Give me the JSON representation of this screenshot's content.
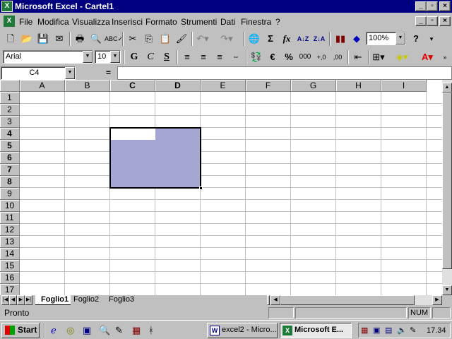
{
  "window": {
    "title": "Microsoft Excel - Cartel1"
  },
  "menu": [
    {
      "label": "File"
    },
    {
      "label": "Modifica"
    },
    {
      "label": "Visualizza"
    },
    {
      "label": "Inserisci"
    },
    {
      "label": "Formato"
    },
    {
      "label": "Strumenti"
    },
    {
      "label": "Dati"
    },
    {
      "label": "Finestra"
    },
    {
      "label": "?"
    }
  ],
  "standard_toolbar": {
    "zoom": "100%",
    "sigma": "Σ",
    "fx": "fx"
  },
  "format_toolbar": {
    "font": "Arial",
    "size": "10",
    "bold": "G",
    "italic": "C",
    "underline": "S",
    "euro": "€",
    "percent": "%",
    "thousands": "000",
    "inc_dec": "+,0",
    "dec_dec": ",00"
  },
  "formula_bar": {
    "name_box": "C4",
    "equals": "=",
    "content": ""
  },
  "columns": [
    "A",
    "B",
    "C",
    "D",
    "E",
    "F",
    "G",
    "H",
    "I"
  ],
  "rows": [
    "1",
    "2",
    "3",
    "4",
    "5",
    "6",
    "7",
    "8",
    "9",
    "10",
    "11",
    "12",
    "13",
    "14",
    "15",
    "16",
    "17"
  ],
  "selection": {
    "range": "C4:D8",
    "active": "C4",
    "highlight": "#a6a6d2"
  },
  "sheets": [
    {
      "label": "Foglio1"
    },
    {
      "label": "Foglio2"
    },
    {
      "label": "Foglio3"
    }
  ],
  "status": {
    "text": "Pronto",
    "num": "NUM"
  },
  "taskbar": {
    "start": "Start",
    "tasks": [
      {
        "label": "excel2 - Micro..."
      },
      {
        "label": "Microsoft E..."
      }
    ],
    "clock": "17.34"
  }
}
